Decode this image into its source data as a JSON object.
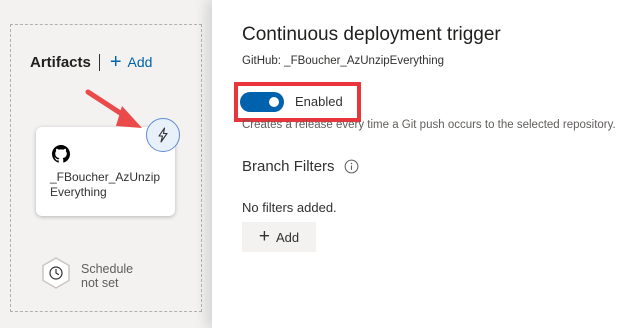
{
  "pipeline": {
    "artifacts_title": "Artifacts",
    "add_label": "Add",
    "artifact": {
      "name": "_FBoucher_AzUnzipEverything",
      "icon": "github-icon"
    },
    "trigger_icon": "lightning-bolt-icon",
    "schedule": {
      "line1": "Schedule",
      "line2": "not set",
      "icon": "clock-icon"
    }
  },
  "panel": {
    "title": "Continuous deployment trigger",
    "subtitle": "GitHub: _FBoucher_AzUnzipEverything",
    "toggle": {
      "state": "on",
      "label": "Enabled",
      "description": "Creates a release every time a Git push occurs to the selected repository."
    },
    "branch_filters": {
      "title": "Branch Filters",
      "empty_text": "No filters added.",
      "add_label": "Add",
      "info_icon": "info-icon"
    }
  },
  "colors": {
    "accent": "#0062ad",
    "highlight": "#e8343a",
    "canvas_bg": "#f3f2f1"
  }
}
